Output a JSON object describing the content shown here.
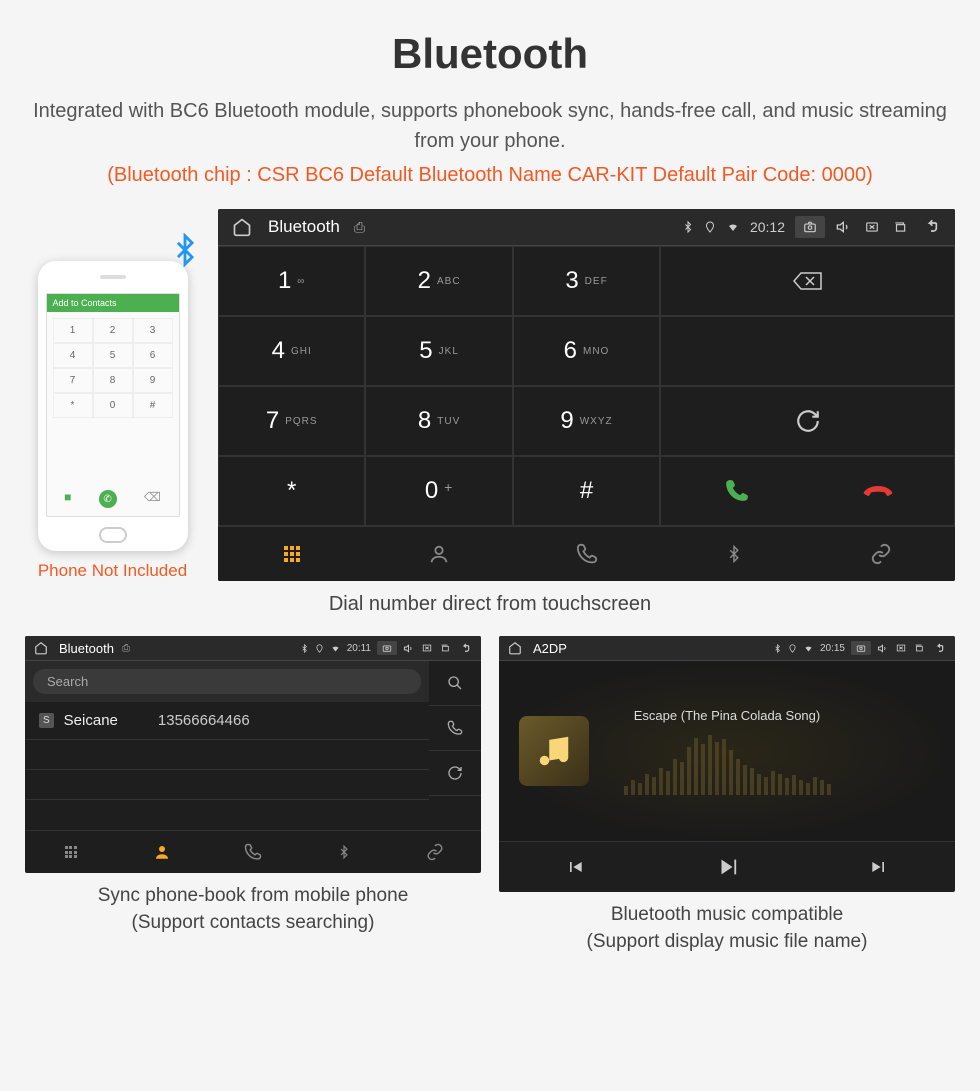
{
  "header": {
    "title": "Bluetooth",
    "subtitle": "Integrated with BC6 Bluetooth module, supports phonebook sync, hands-free call, and music streaming from your phone.",
    "specs": "(Bluetooth chip : CSR BC6    Default Bluetooth Name CAR-KIT    Default Pair Code: 0000)"
  },
  "phone": {
    "bar_label": "Add to Contacts",
    "caption": "Phone Not Included",
    "keys": [
      "1",
      "2",
      "3",
      "4",
      "5",
      "6",
      "7",
      "8",
      "9",
      "*",
      "0",
      "#"
    ]
  },
  "dialer": {
    "statusbar": {
      "title": "Bluetooth",
      "time": "20:12",
      "usb": "�psi"
    },
    "keys": [
      {
        "num": "1",
        "sub": "∞"
      },
      {
        "num": "2",
        "sub": "ABC"
      },
      {
        "num": "3",
        "sub": "DEF"
      },
      {
        "num": "4",
        "sub": "GHI"
      },
      {
        "num": "5",
        "sub": "JKL"
      },
      {
        "num": "6",
        "sub": "MNO"
      },
      {
        "num": "7",
        "sub": "PQRS"
      },
      {
        "num": "8",
        "sub": "TUV"
      },
      {
        "num": "9",
        "sub": "WXYZ"
      },
      {
        "num": "*",
        "sub": ""
      },
      {
        "num": "0",
        "sub": "+"
      },
      {
        "num": "#",
        "sub": ""
      }
    ],
    "caption": "Dial number direct from touchscreen"
  },
  "contacts": {
    "statusbar": {
      "title": "Bluetooth",
      "time": "20:11"
    },
    "search_placeholder": "Search",
    "items": [
      {
        "badge": "S",
        "name": "Seicane",
        "phone": "13566664466"
      }
    ],
    "caption_line1": "Sync phone-book from mobile phone",
    "caption_line2": "(Support contacts searching)"
  },
  "music": {
    "statusbar": {
      "title": "A2DP",
      "time": "20:15"
    },
    "song": "Escape (The Pina Colada Song)",
    "caption_line1": "Bluetooth music compatible",
    "caption_line2": "(Support display music file name)"
  }
}
